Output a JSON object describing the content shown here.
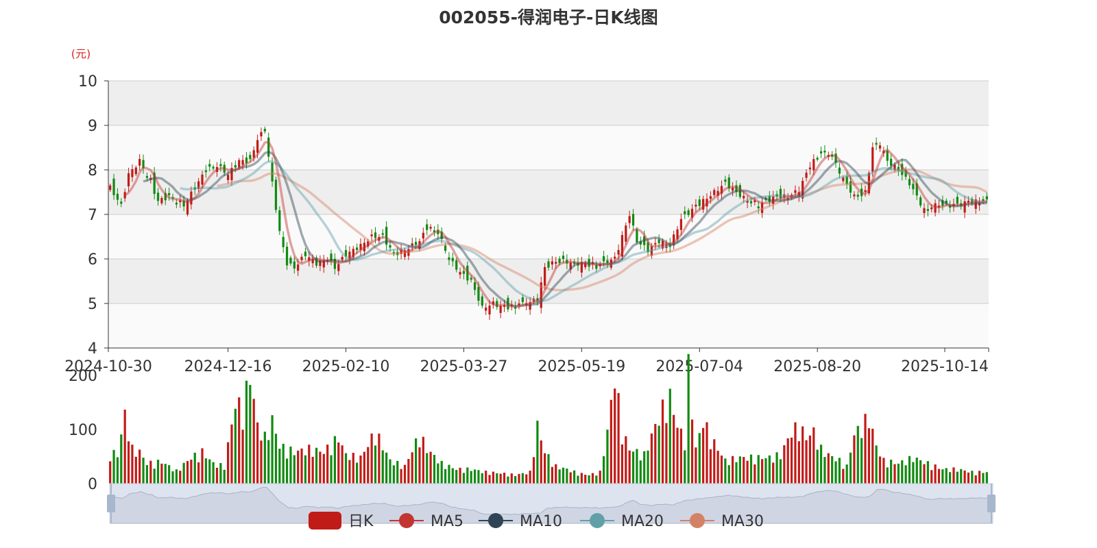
{
  "title": "002055-得润电子-日K线图",
  "colors": {
    "up": "#c11b17",
    "down": "#128a12",
    "ma5": "#c23531",
    "ma10": "#2f4554",
    "ma20": "#61a0a8",
    "ma30": "#d48265",
    "band_dark": "#eeeeee",
    "band_light": "#fafafa"
  },
  "chart_data": [
    {
      "type": "candlestick",
      "title": "002055-得润电子-日K线图",
      "ylabel": "(元)",
      "ylim": [
        4,
        10
      ],
      "yticks": [
        "4",
        "5",
        "6",
        "7",
        "8",
        "9",
        "10"
      ],
      "xticks": [
        {
          "label": "2024-10-30",
          "index": 0
        },
        {
          "label": "2024-12-16",
          "index": 32
        },
        {
          "label": "2025-02-10",
          "index": 64
        },
        {
          "label": "2025-03-27",
          "index": 96
        },
        {
          "label": "2025-05-19",
          "index": 128
        },
        {
          "label": "2025-07-04",
          "index": 160
        },
        {
          "label": "2025-08-20",
          "index": 192
        },
        {
          "label": "2025-10-14",
          "index": 224
        }
      ],
      "grid": true,
      "legend": [
        "日K",
        "MA5",
        "MA10",
        "MA20",
        "MA30"
      ],
      "legend_position": "bottom",
      "close_anchors": [
        [
          0,
          7.6
        ],
        [
          3,
          7.2
        ],
        [
          5,
          7.9
        ],
        [
          8,
          8.2
        ],
        [
          10,
          7.9
        ],
        [
          13,
          7.3
        ],
        [
          16,
          7.4
        ],
        [
          20,
          7.2
        ],
        [
          23,
          7.6
        ],
        [
          26,
          8.0
        ],
        [
          29,
          8.1
        ],
        [
          32,
          7.9
        ],
        [
          35,
          8.2
        ],
        [
          38,
          8.2
        ],
        [
          40,
          8.7
        ],
        [
          42,
          8.9
        ],
        [
          44,
          7.7
        ],
        [
          46,
          6.6
        ],
        [
          48,
          5.9
        ],
        [
          50,
          5.8
        ],
        [
          53,
          6.1
        ],
        [
          56,
          5.9
        ],
        [
          59,
          6.0
        ],
        [
          61,
          5.8
        ],
        [
          64,
          6.1
        ],
        [
          68,
          6.3
        ],
        [
          71,
          6.5
        ],
        [
          74,
          6.5
        ],
        [
          77,
          6.1
        ],
        [
          80,
          6.2
        ],
        [
          84,
          6.4
        ],
        [
          86,
          6.7
        ],
        [
          89,
          6.6
        ],
        [
          92,
          6.0
        ],
        [
          95,
          5.7
        ],
        [
          98,
          5.5
        ],
        [
          101,
          4.9
        ],
        [
          104,
          5.0
        ],
        [
          107,
          4.9
        ],
        [
          110,
          4.95
        ],
        [
          113,
          5.0
        ],
        [
          116,
          5.1
        ],
        [
          118,
          5.8
        ],
        [
          120,
          5.9
        ],
        [
          123,
          5.95
        ],
        [
          126,
          5.9
        ],
        [
          129,
          5.9
        ],
        [
          132,
          5.8
        ],
        [
          135,
          5.95
        ],
        [
          137,
          6.0
        ],
        [
          139,
          6.5
        ],
        [
          141,
          7.0
        ],
        [
          143,
          6.4
        ],
        [
          146,
          6.2
        ],
        [
          149,
          6.4
        ],
        [
          152,
          6.3
        ],
        [
          155,
          6.9
        ],
        [
          158,
          7.1
        ],
        [
          161,
          7.3
        ],
        [
          164,
          7.5
        ],
        [
          167,
          7.7
        ],
        [
          170,
          7.5
        ],
        [
          173,
          7.3
        ],
        [
          176,
          7.2
        ],
        [
          178,
          7.3
        ],
        [
          181,
          7.4
        ],
        [
          184,
          7.4
        ],
        [
          187,
          7.55
        ],
        [
          190,
          8.1
        ],
        [
          193,
          8.4
        ],
        [
          196,
          8.3
        ],
        [
          199,
          7.8
        ],
        [
          202,
          7.4
        ],
        [
          205,
          7.45
        ],
        [
          207,
          8.5
        ],
        [
          209,
          8.6
        ],
        [
          211,
          8.2
        ],
        [
          214,
          8.0
        ],
        [
          217,
          7.7
        ],
        [
          219,
          7.4
        ],
        [
          221,
          7.1
        ],
        [
          224,
          7.2
        ],
        [
          228,
          7.2
        ],
        [
          232,
          7.25
        ],
        [
          236,
          7.3
        ],
        [
          238,
          7.3
        ]
      ],
      "volume": {
        "ylim": [
          0,
          200
        ],
        "yticks": [
          "0",
          "100",
          "200"
        ],
        "volume_anchors": [
          [
            0,
            55
          ],
          [
            2,
            50
          ],
          [
            4,
            120
          ],
          [
            6,
            60
          ],
          [
            8,
            55
          ],
          [
            10,
            35
          ],
          [
            14,
            38
          ],
          [
            18,
            22
          ],
          [
            22,
            45
          ],
          [
            25,
            55
          ],
          [
            28,
            35
          ],
          [
            31,
            30
          ],
          [
            34,
            140
          ],
          [
            36,
            130
          ],
          [
            38,
            190
          ],
          [
            40,
            100
          ],
          [
            42,
            80
          ],
          [
            44,
            110
          ],
          [
            46,
            65
          ],
          [
            50,
            55
          ],
          [
            54,
            60
          ],
          [
            58,
            55
          ],
          [
            62,
            80
          ],
          [
            64,
            50
          ],
          [
            68,
            45
          ],
          [
            72,
            90
          ],
          [
            76,
            40
          ],
          [
            80,
            30
          ],
          [
            84,
            85
          ],
          [
            86,
            60
          ],
          [
            90,
            35
          ],
          [
            94,
            25
          ],
          [
            98,
            25
          ],
          [
            102,
            20
          ],
          [
            106,
            18
          ],
          [
            110,
            15
          ],
          [
            114,
            20
          ],
          [
            116,
            100
          ],
          [
            118,
            55
          ],
          [
            121,
            30
          ],
          [
            124,
            25
          ],
          [
            127,
            18
          ],
          [
            130,
            15
          ],
          [
            133,
            20
          ],
          [
            135,
            90
          ],
          [
            137,
            190
          ],
          [
            139,
            90
          ],
          [
            141,
            60
          ],
          [
            145,
            50
          ],
          [
            148,
            100
          ],
          [
            150,
            130
          ],
          [
            152,
            150
          ],
          [
            154,
            100
          ],
          [
            156,
            75
          ],
          [
            157,
            200
          ],
          [
            159,
            60
          ],
          [
            161,
            110
          ],
          [
            163,
            80
          ],
          [
            165,
            60
          ],
          [
            167,
            40
          ],
          [
            171,
            45
          ],
          [
            175,
            45
          ],
          [
            179,
            45
          ],
          [
            182,
            50
          ],
          [
            185,
            90
          ],
          [
            187,
            100
          ],
          [
            189,
            80
          ],
          [
            191,
            90
          ],
          [
            193,
            60
          ],
          [
            195,
            50
          ],
          [
            198,
            40
          ],
          [
            200,
            30
          ],
          [
            202,
            85
          ],
          [
            204,
            100
          ],
          [
            206,
            115
          ],
          [
            208,
            65
          ],
          [
            210,
            40
          ],
          [
            214,
            35
          ],
          [
            218,
            45
          ],
          [
            222,
            35
          ],
          [
            226,
            25
          ],
          [
            230,
            25
          ],
          [
            234,
            20
          ],
          [
            238,
            20
          ]
        ]
      }
    }
  ]
}
